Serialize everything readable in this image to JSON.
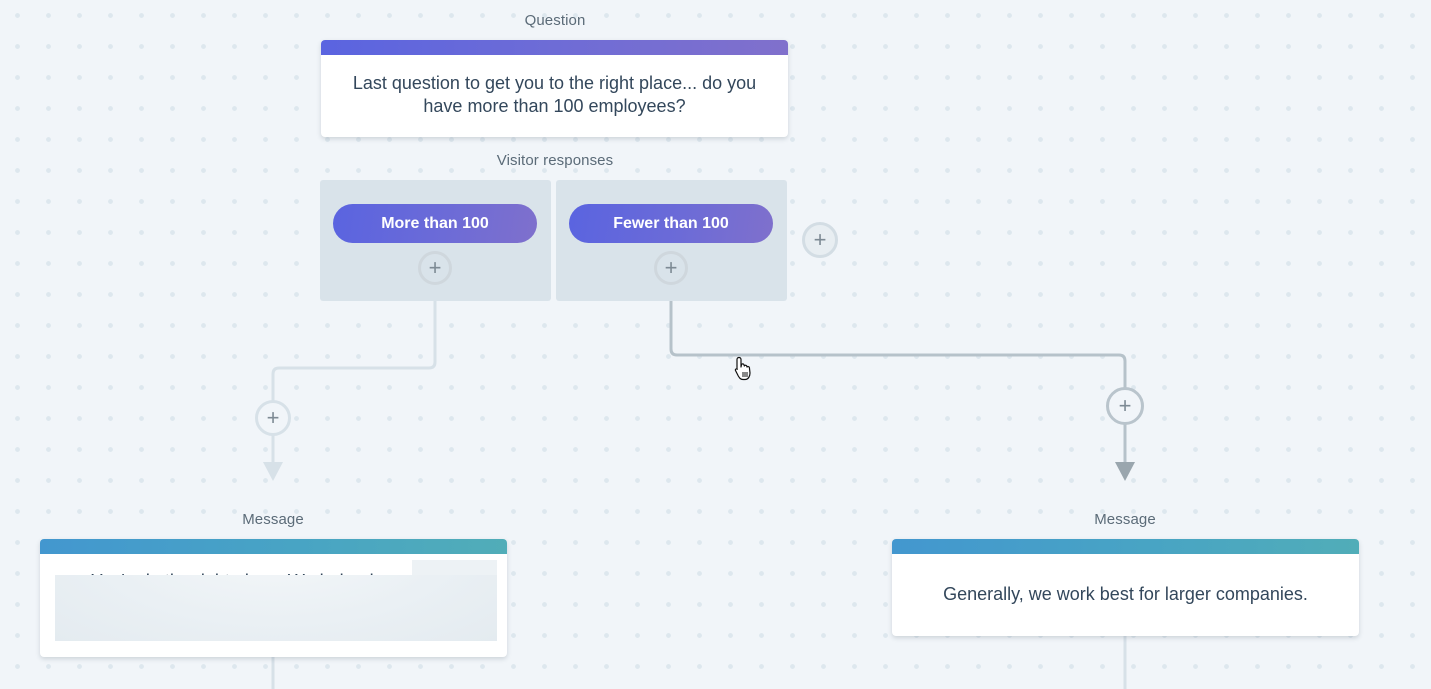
{
  "canvas": {
    "background_color": "#f1f5f9",
    "dot_color": "#dde7ee"
  },
  "question_node": {
    "label": "Question",
    "text": "Last question to get you to the right place... do you have more than 100 employees?",
    "accent_color": "#6a6ad8"
  },
  "visitor_responses": {
    "label": "Visitor responses",
    "options": [
      {
        "label": "More than 100"
      },
      {
        "label": "Fewer than 100"
      }
    ],
    "add_response_icon": "plus-icon"
  },
  "connectors": [
    {
      "from": "More than 100",
      "to": "Message (left)",
      "add_step_icon": "plus-icon",
      "highlighted": false
    },
    {
      "from": "Fewer than 100",
      "to": "Message (right)",
      "add_step_icon": "plus-icon",
      "highlighted": true
    }
  ],
  "message_nodes": [
    {
      "label": "Message",
      "text": "You're in the right place. We helped a ",
      "accent_color": "#459fc9"
    },
    {
      "label": "Message",
      "text": "Generally, we work best for larger companies.",
      "accent_color": "#459fc9"
    }
  ],
  "icons": {
    "plus": "+",
    "cursor": "hand-pointer-icon"
  }
}
